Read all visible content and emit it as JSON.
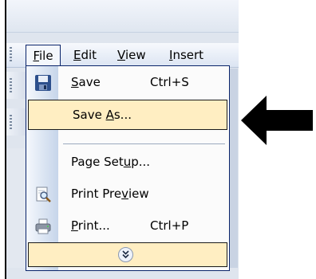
{
  "menubar": {
    "items": [
      {
        "label": "File",
        "u": "F",
        "rest": "ile"
      },
      {
        "label": "Edit",
        "u": "E",
        "rest": "dit"
      },
      {
        "label": "View",
        "u": "V",
        "rest": "iew"
      },
      {
        "label": "Insert",
        "u": "I",
        "rest": "nsert"
      }
    ]
  },
  "file_menu": {
    "save": {
      "pre": "",
      "u": "S",
      "post": "ave",
      "shortcut": "Ctrl+S"
    },
    "save_as": {
      "pre": "Save ",
      "u": "A",
      "post": "s..."
    },
    "page_setup": {
      "pre": "Page Set",
      "u": "u",
      "post": "p..."
    },
    "print_preview": {
      "pre": "Print Pre",
      "u": "v",
      "post": "iew"
    },
    "print": {
      "pre": "",
      "u": "P",
      "post": "rint...",
      "shortcut": "Ctrl+P"
    }
  },
  "icons": {
    "save": "floppy-disk-icon",
    "print_preview": "print-preview-icon",
    "print": "printer-icon",
    "expand": "double-chevron-down-icon",
    "pointer": "black-arrow-pointer"
  },
  "colors": {
    "highlight": "#ffeec2",
    "menu_border": "#0a246a",
    "arrow": "#000000"
  }
}
